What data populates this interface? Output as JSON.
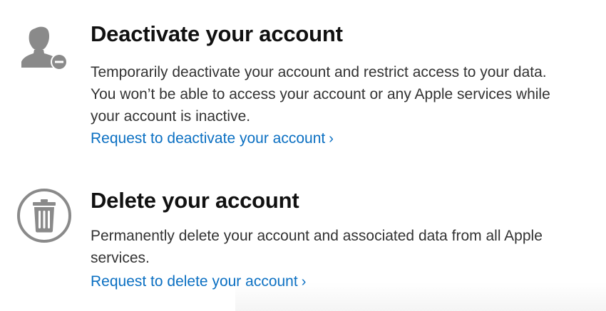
{
  "deactivate": {
    "icon": "person-minus-icon",
    "title": "Deactivate your account",
    "description_lines": [
      "Temporarily deactivate your account and restrict access to your data.",
      "You won’t be able to access your account or any Apple services while",
      "your account is inactive."
    ],
    "link": "Request to deactivate your account",
    "link_chevron": "›"
  },
  "delete": {
    "icon": "trash-icon",
    "title": "Delete your account",
    "description_lines": [
      "Permanently delete your account and associated data from all Apple",
      "services."
    ],
    "link": "Request to delete your account",
    "link_chevron": "›"
  },
  "colors": {
    "icon_gray": "#8a8a8a",
    "link_blue": "#0a6fc2",
    "title": "#111111",
    "text": "#333333"
  }
}
